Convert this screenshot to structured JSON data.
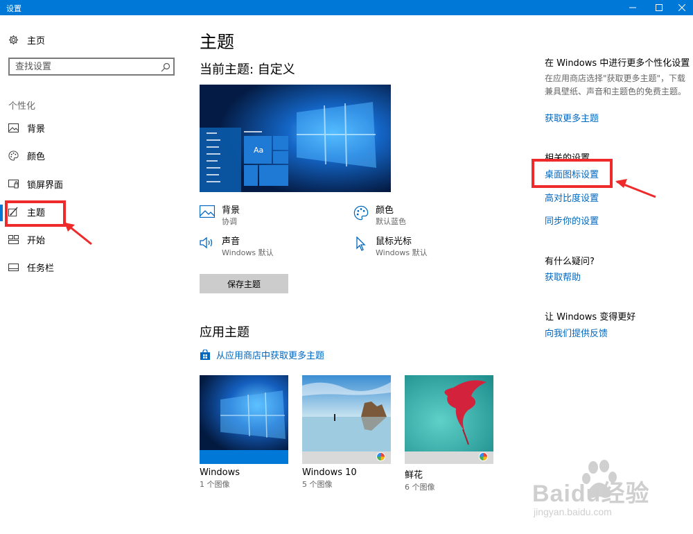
{
  "window": {
    "title": "设置"
  },
  "sidebar": {
    "home_label": "主页",
    "search_placeholder": "查找设置",
    "category": "个性化",
    "items": [
      {
        "label": "背景",
        "icon": "picture-icon"
      },
      {
        "label": "颜色",
        "icon": "palette-icon"
      },
      {
        "label": "锁屏界面",
        "icon": "lock-screen-icon"
      },
      {
        "label": "主题",
        "icon": "theme-brush-icon",
        "selected": true
      },
      {
        "label": "开始",
        "icon": "start-menu-icon"
      },
      {
        "label": "任务栏",
        "icon": "taskbar-icon"
      }
    ]
  },
  "main": {
    "title": "主题",
    "current_theme": "当前主题: 自定义",
    "attributes": [
      {
        "name": "背景",
        "value": "协调",
        "icon": "picture-icon"
      },
      {
        "name": "颜色",
        "value": "默认蓝色",
        "icon": "palette-icon"
      },
      {
        "name": "声音",
        "value": "Windows 默认",
        "icon": "speaker-icon"
      },
      {
        "name": "鼠标光标",
        "value": "Windows 默认",
        "icon": "cursor-icon"
      }
    ],
    "save_button": "保存主题",
    "apply_heading": "应用主题",
    "store_link": "从应用商店中获取更多主题",
    "themes": [
      {
        "name": "Windows",
        "count": "1 个图像"
      },
      {
        "name": "Windows 10",
        "count": "5 个图像"
      },
      {
        "name": "鲜花",
        "count": "6 个图像"
      }
    ]
  },
  "right": {
    "personalize_heading": "在 Windows 中进行更多个性化设置",
    "personalize_desc": "在应用商店选择\"获取更多主题\"，下载兼具壁纸、声音和主题色的免费主题。",
    "get_more_link": "获取更多主题",
    "related_heading": "相关的设置",
    "desktop_icon_link": "桌面图标设置",
    "contrast_link": "高对比度设置",
    "sync_link": "同步你的设置",
    "question_heading": "有什么疑问?",
    "help_link": "获取帮助",
    "better_heading": "让 Windows 变得更好",
    "feedback_link": "向我们提供反馈"
  },
  "watermark": {
    "brand": "Baidu经验",
    "url": "jingyan.baidu.com"
  },
  "colors": {
    "accent": "#0078d7",
    "link": "#0067c0",
    "annotation_red": "#ee2a2a"
  }
}
